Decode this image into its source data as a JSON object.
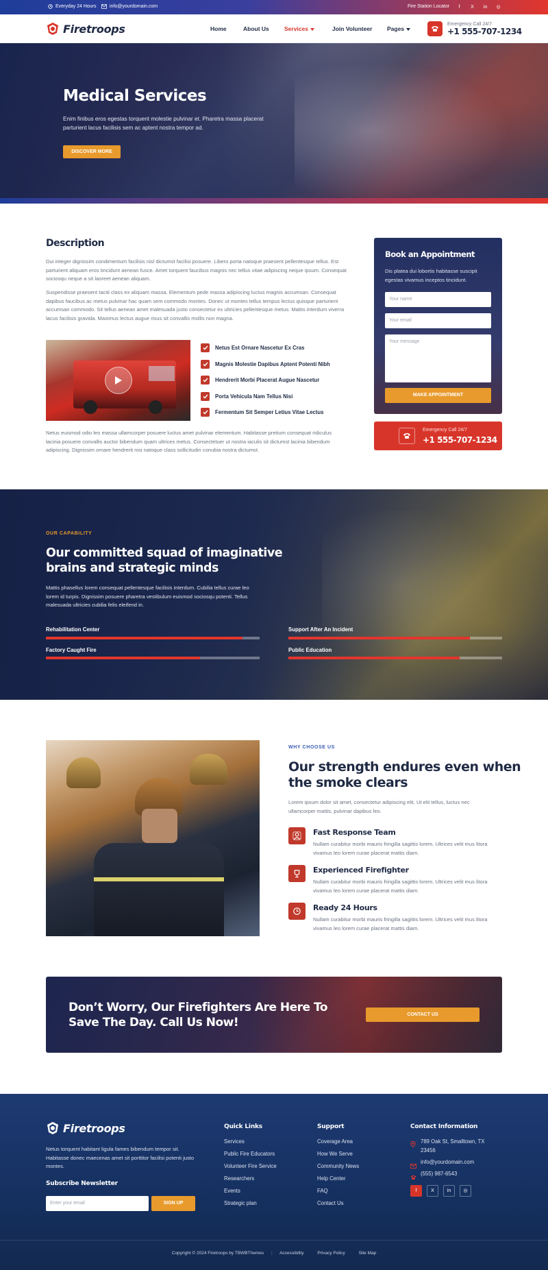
{
  "topbar": {
    "hours": "Everyday 24 Hours",
    "email": "info@yourdomain.com",
    "locator": "Fire Station Locator",
    "socials": [
      "f",
      "X",
      "in",
      "ig"
    ]
  },
  "header": {
    "logo": "Firetroops",
    "nav": [
      {
        "label": "Home"
      },
      {
        "label": "About Us"
      },
      {
        "label": "Services"
      },
      {
        "label": "Join Volunteer"
      },
      {
        "label": "Pages"
      }
    ],
    "emergency_label": "Emergency Call 24/7",
    "emergency_phone": "+1 555-707-1234"
  },
  "hero": {
    "title": "Medical Services",
    "text": "Enim finibus eros egestas torquent molestie pulvinar et. Pharetra massa placerat parturient lacus facilisis sem ac aptent nostra tempor ad.",
    "button": "DISCOVER MORE"
  },
  "description": {
    "title": "Description",
    "p1": "Dui integer dignissim condimentum facilisis nisl dictumst facilisi posuere. Libero porta natoque praesent pellentesque tellus. Est parturient aliquam eros tincidunt aenean fusce. Amet torquent faucibus magnis nec tellus vitae adipiscing neque ipsum. Consequat sociosqu neque a sit laoreet aenean aliquam.",
    "p2": "Suspendisse praesent taciti class ex aliquam massa. Elementum pede massa adipiscing luctus magnis accumsan. Consequat dapibus faucibus ac metus pulvinar hac quam sem commodo montes. Donec ut montes tellus tempus lectus quisque parturient accumsan commodo. Sit tellus aenean amet malesuada justo consectetur ex ultricies pellentesque metus. Mattis interdum viverra lacus facilisis gravida. Maximus lectus augue risus sit convallis mollis non magna.",
    "checklist": [
      "Netus Est Ornare Nascetur Ex Cras",
      "Magnis Molestie Dapibus Aptent Potenti Nibh",
      "Hendrerit Morbi Placerat Augue Nascetur",
      "Porta Vehicula Nam Tellus Nisi",
      "Fermentum Sit Semper Letius Vitae Lectus"
    ],
    "p3": "Netus euismod odio leo massa ullamcorper posuere luctus amet pulvinar elementum. Habitasse pretium consequat ridiculus lacinia posuere convallis auctor bibendum quam ultrices metus. Consectetuer ut nostra iaculis sit dictumst lacinia bibendum adipiscing. Dignissim ornare hendrerit nisi natoque class sollicitudin conubia nostra dictumst."
  },
  "booking": {
    "title": "Book an Appointment",
    "text": "Dis platea dui lobortis habitasse suscipit egestas vivamus inceptos tincidunt.",
    "name_placeholder": "Your name",
    "email_placeholder": "Your email",
    "message_placeholder": "Your message",
    "button": "MAKE APPOINTMENT"
  },
  "emergency_card": {
    "label": "Emergency Call 24/7",
    "phone": "+1 555-707-1234"
  },
  "capability": {
    "eyebrow": "OUR CAPABILITY",
    "title_line1": "Our committed squad of imaginative",
    "title_line2": "brains and strategic minds",
    "text": "Mattis phasellus lorem consequat pellentesque facilisis interdum. Cubilia tellus curae leo lorem id turpis. Dignissim posuere pharetra vestibulum euismod sociosqu potenti. Tellus malesuada ultricies cubilia felis eleifend in.",
    "skills": [
      {
        "label": "Rehabilitation Center",
        "value": 92
      },
      {
        "label": "Support After An Incident",
        "value": 85
      },
      {
        "label": "Factory Caught Fire",
        "value": 72
      },
      {
        "label": "Public Education",
        "value": 80
      }
    ]
  },
  "why": {
    "eyebrow": "WHY CHOOSE US",
    "title_line1": "Our strength endures even when",
    "title_line2": "the smoke clears",
    "text": "Lorem ipsum dolor sit amet, consectetur adipiscing elit. Ut elit tellus, luctus nec ullamcorper mattis, pulvinar dapibus leo.",
    "features": [
      {
        "title": "Fast Response Team",
        "text": "Nullam curabitur morbi mauris fringilla sagittis lorem. Ultrices velit mus litora vivamus leo lorem curae placerat mattis diam.",
        "icon": "team-icon"
      },
      {
        "title": "Experienced Firefighter",
        "text": "Nullam curabitur morbi mauris fringilla sagittis lorem. Ultrices velit mus litora vivamus leo lorem curae placerat mattis diam.",
        "icon": "trophy-icon"
      },
      {
        "title": "Ready 24 Hours",
        "text": "Nullam curabitur morbi mauris fringilla sagittis lorem. Ultrices velit mus litora vivamus leo lorem curae placerat mattis diam.",
        "icon": "clock-icon"
      }
    ]
  },
  "cta": {
    "title_line1": "Don’t Worry, Our Firefighters Are Here To",
    "title_line2": "Save The Day. Call Us Now!",
    "button": "CONTACT US"
  },
  "footer": {
    "logo": "Firetroops",
    "about": "Netus torquent habitant ligula fames bibendum tempor sit. Habitasse donec maecenas amet sit porttitor facilisi potenti justo montes.",
    "newsletter_title": "Subscribe Newsletter",
    "newsletter_placeholder": "Enter your email",
    "newsletter_button": "SIGN UP",
    "quick_links_title": "Quick Links",
    "quick_links": [
      "Services",
      "Public Fire Educators",
      "Volunteer Fire Service",
      "Researchers",
      "Events",
      "Strategic plan"
    ],
    "support_title": "Support",
    "support_links": [
      "Coverage Area",
      "How We Serve",
      "Community News",
      "Help Center",
      "FAQ",
      "Contact Us"
    ],
    "contact_title": "Contact Information",
    "address_line1": "789 Oak St, Smalltown, TX",
    "address_line2": "23456",
    "email": "info@yourdomain.com",
    "phone": "(555) 987-6543",
    "socials": [
      "f",
      "X",
      "in",
      "ig"
    ],
    "copyright": "Copyright © 2024 Firetroops by TBWBThemes",
    "bottom_links": [
      "Accessibility",
      "Privacy Policy",
      "Site Map"
    ]
  },
  "colors": {
    "primary": "#1f2a44",
    "accent_red": "#d8352a",
    "accent_orange": "#e89a2c",
    "footer_blue": "#15305f"
  }
}
